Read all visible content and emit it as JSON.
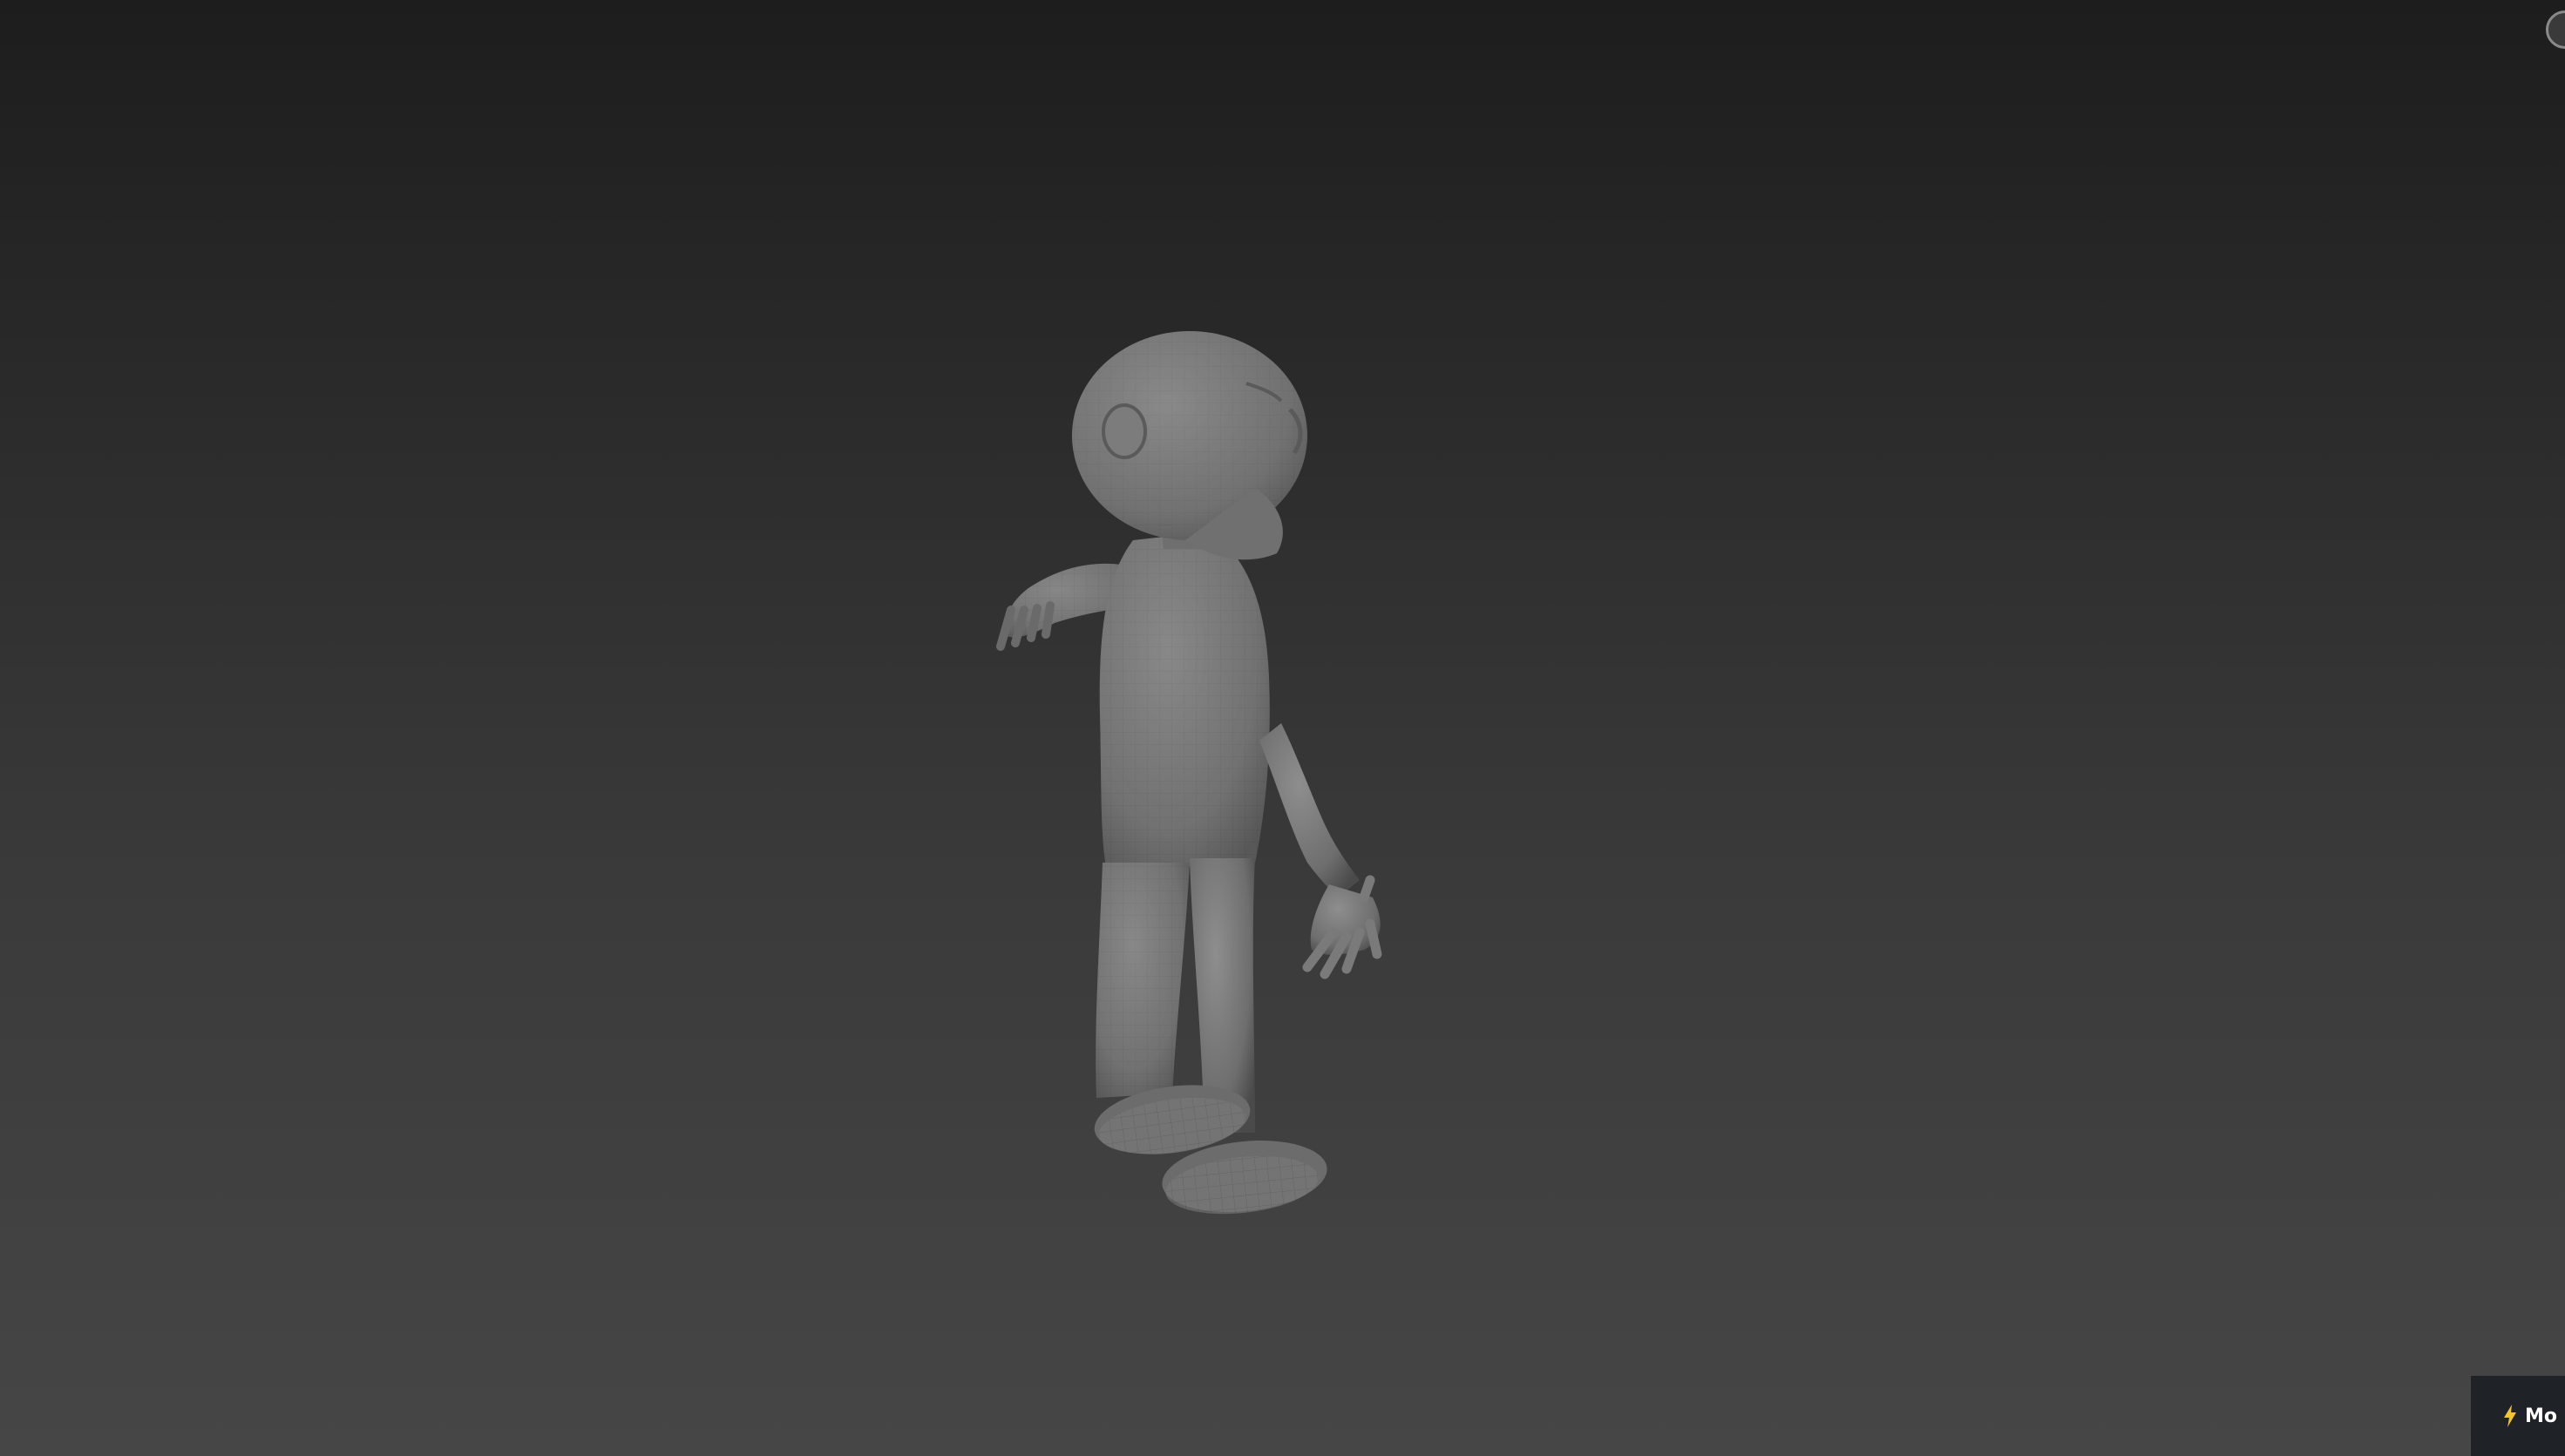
{
  "viewport": {
    "background_top": "#1d1d1d",
    "background_bottom": "#464646",
    "model": "wireframe-shaded-character"
  },
  "overlay": {
    "viewcube_icon": "viewcube-icon",
    "mode_badge": {
      "icon": "lightning-bolt-icon",
      "label": "Mo",
      "accent": "#f2c230"
    }
  }
}
